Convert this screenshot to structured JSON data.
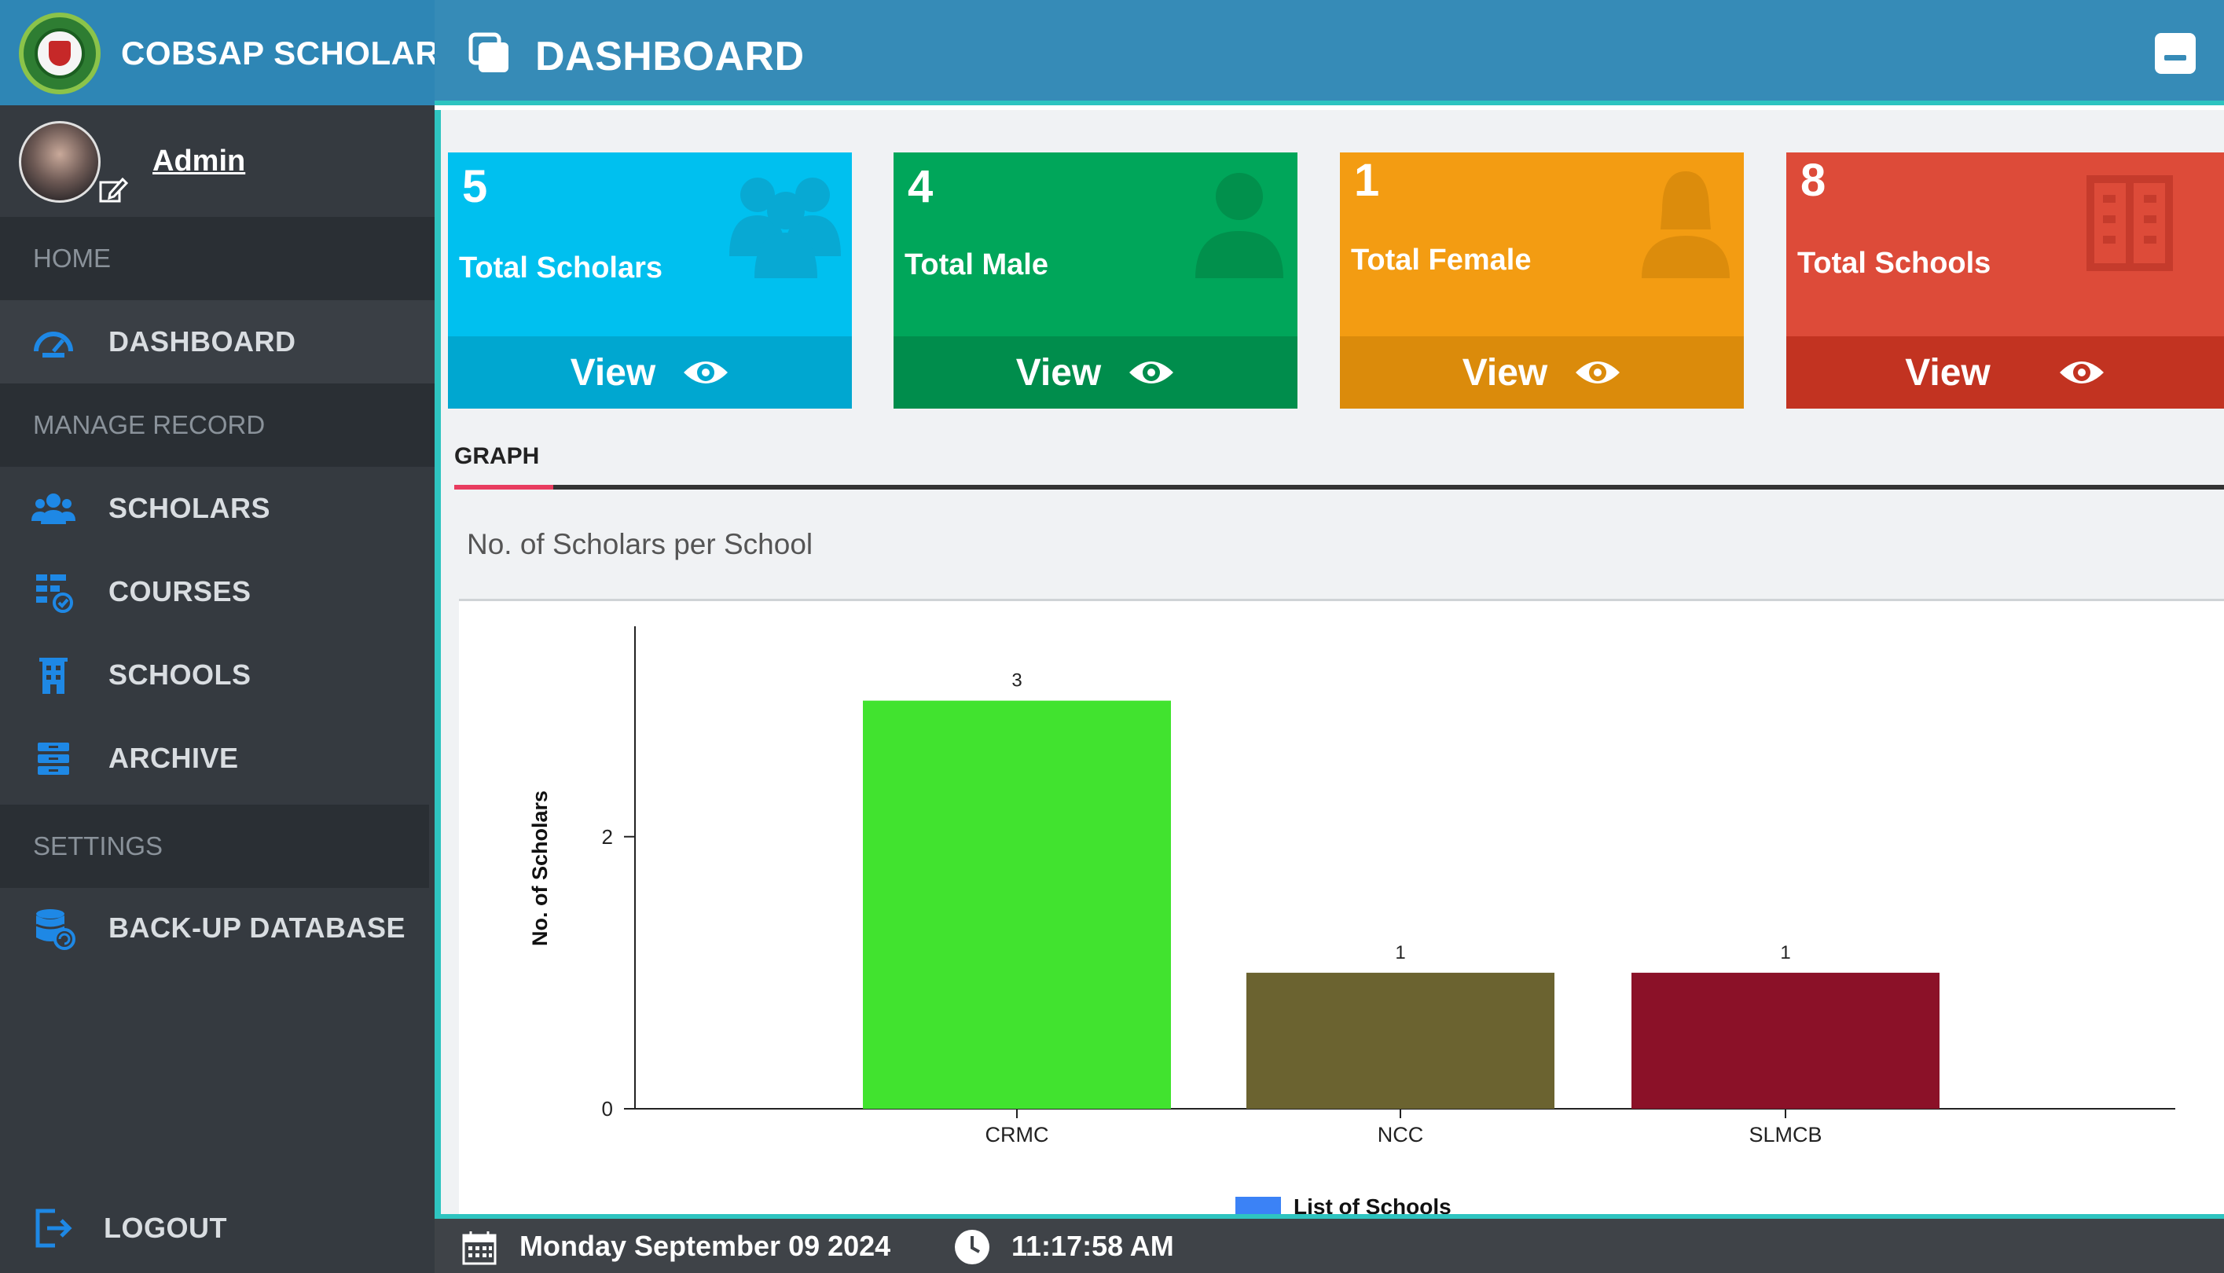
{
  "app": {
    "brand": "COBSAP SCHOLAR",
    "logo_icon": "seal-logo"
  },
  "user": {
    "name": "Admin",
    "edit_icon": "edit-profile-icon"
  },
  "sidebar": {
    "sections": [
      {
        "header": "HOME",
        "items": [
          {
            "label": "DASHBOARD",
            "icon": "dashboard-gauge-icon",
            "active": true
          }
        ]
      },
      {
        "header": "MANAGE RECORD",
        "items": [
          {
            "label": "SCHOLARS",
            "icon": "users-icon"
          },
          {
            "label": "COURSES",
            "icon": "courses-icon"
          },
          {
            "label": "SCHOOLS",
            "icon": "building-icon"
          },
          {
            "label": "ARCHIVE",
            "icon": "archive-icon"
          }
        ]
      },
      {
        "header": "SETTINGS",
        "items": [
          {
            "label": "BACK-UP DATABASE",
            "icon": "database-backup-icon"
          }
        ]
      }
    ],
    "logout": "LOGOUT"
  },
  "header": {
    "title": "DASHBOARD"
  },
  "cards": [
    {
      "count": "5",
      "label": "Total Scholars",
      "action": "View",
      "color": "#00c0ef",
      "footer_color": "#00a7d0",
      "icon": "group-icon"
    },
    {
      "count": "4",
      "label": "Total Male",
      "action": "View",
      "color": "#00a65a",
      "footer_color": "#008d4c",
      "icon": "male-icon"
    },
    {
      "count": "1",
      "label": "Total Female",
      "action": "View",
      "color": "#f39c12",
      "footer_color": "#db8b0b",
      "icon": "female-icon"
    },
    {
      "count": "8",
      "label": "Total Schools",
      "action": "View",
      "color": "#dd4b39",
      "footer_color": "#c23321",
      "icon": "school-building-icon"
    }
  ],
  "tabs": [
    {
      "label": "GRAPH",
      "active": true
    }
  ],
  "chart": {
    "title": "No. of Scholars per School"
  },
  "chart_data": {
    "type": "bar",
    "categories": [
      "CRMC",
      "NCC",
      "SLMCB"
    ],
    "series": [
      {
        "name": "List of Schools",
        "values": [
          3,
          1,
          1
        ]
      }
    ],
    "bar_colors": [
      "#41e32f",
      "#6b6330",
      "#8b1128"
    ],
    "data_labels": [
      "3",
      "1",
      "1"
    ],
    "xlabel": "",
    "ylabel": "No. of Scholars",
    "ylim": [
      0,
      3.2
    ],
    "yticks": [
      "0",
      "2"
    ],
    "legend": "bottom",
    "legend_color": "#3b82f6"
  },
  "footer": {
    "date": "Monday September 09 2024",
    "time": "11:17:58 AM"
  }
}
